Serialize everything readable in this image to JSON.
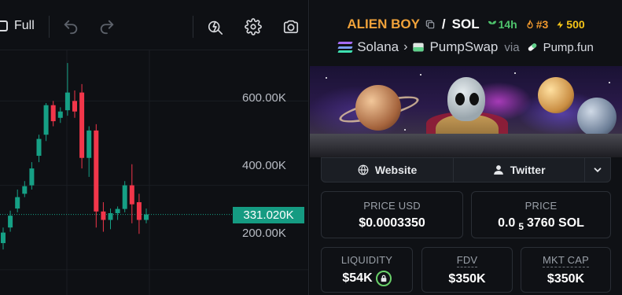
{
  "toolbar": {
    "full_label": "Full",
    "icons": [
      "undo-icon",
      "redo-icon",
      "indicator-icon",
      "settings-icon",
      "camera-icon"
    ]
  },
  "chart": {
    "current_price_label": "331.020K",
    "y_ticks": [
      "600.00K",
      "400.00K",
      "200.00K"
    ],
    "up_color": "#16a085",
    "down_color": "#f2364a"
  },
  "chart_data": {
    "type": "candlestick",
    "y_unit": "K",
    "ylim": [
      140,
      720
    ],
    "candles": [
      {
        "o": 263,
        "h": 300,
        "l": 248,
        "c": 288
      },
      {
        "o": 300,
        "h": 340,
        "l": 290,
        "c": 328
      },
      {
        "o": 345,
        "h": 390,
        "l": 336,
        "c": 372
      },
      {
        "o": 380,
        "h": 410,
        "l": 372,
        "c": 398
      },
      {
        "o": 400,
        "h": 455,
        "l": 390,
        "c": 440
      },
      {
        "o": 470,
        "h": 520,
        "l": 455,
        "c": 510
      },
      {
        "o": 520,
        "h": 595,
        "l": 505,
        "c": 590
      },
      {
        "o": 590,
        "h": 600,
        "l": 540,
        "c": 552
      },
      {
        "o": 560,
        "h": 585,
        "l": 548,
        "c": 575
      },
      {
        "o": 578,
        "h": 690,
        "l": 565,
        "c": 620
      },
      {
        "o": 600,
        "h": 625,
        "l": 560,
        "c": 575
      },
      {
        "o": 620,
        "h": 640,
        "l": 440,
        "c": 465
      },
      {
        "o": 465,
        "h": 540,
        "l": 420,
        "c": 530
      },
      {
        "o": 530,
        "h": 545,
        "l": 300,
        "c": 338
      },
      {
        "o": 338,
        "h": 360,
        "l": 290,
        "c": 318
      },
      {
        "o": 318,
        "h": 345,
        "l": 296,
        "c": 334
      },
      {
        "o": 334,
        "h": 350,
        "l": 318,
        "c": 344
      },
      {
        "o": 344,
        "h": 410,
        "l": 336,
        "c": 400
      },
      {
        "o": 400,
        "h": 450,
        "l": 310,
        "c": 355
      },
      {
        "o": 360,
        "h": 380,
        "l": 285,
        "c": 318
      },
      {
        "o": 318,
        "h": 345,
        "l": 310,
        "c": 331
      }
    ],
    "last_price": 331.02
  },
  "token": {
    "name": "ALIEN BOY",
    "quote": "SOL",
    "age": "14h",
    "rank": "#3",
    "boosts": "500",
    "chain": "Solana",
    "dex": "PumpSwap",
    "via_label": "via",
    "launchpad": "Pump.fun",
    "name_color": "#f0a23a"
  },
  "links": {
    "website": "Website",
    "twitter": "Twitter"
  },
  "stats": {
    "price_usd_label": "PRICE USD",
    "price_usd": "$0.0003350",
    "price_label": "PRICE",
    "price_native_prefix": "0.0",
    "price_native_sub": "5",
    "price_native_rest": "3760 SOL",
    "liquidity_label": "LIQUIDITY",
    "liquidity": "$54K",
    "fdv_label": "FDV",
    "fdv": "$350K",
    "mktcap_label": "MKT CAP",
    "mktcap": "$350K"
  }
}
